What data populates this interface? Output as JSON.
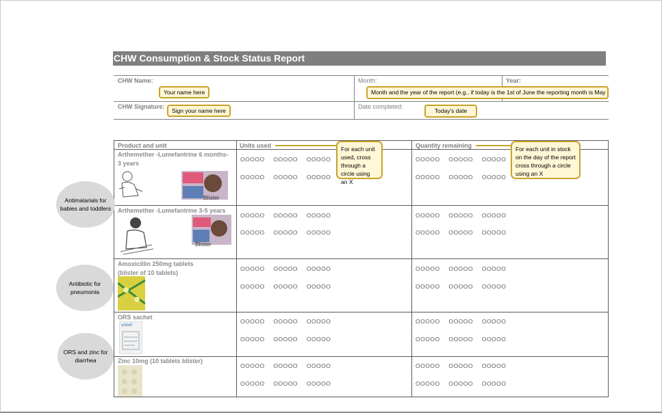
{
  "report": {
    "title": "CHW Consumption & Stock Status Report"
  },
  "header": {
    "chw_name_label": "CHW Name:",
    "chw_name_hint": "Your name here",
    "month_label": "Month:",
    "year_label": "Year:",
    "month_hint": "Month and the year of the report (e.g., if today is the 1st of June the reporting month is May",
    "signature_label": "CHW Signature:",
    "signature_hint": "Sign your name here",
    "date_label": "Date completed:",
    "date_hint": "Today's date"
  },
  "table": {
    "col_product": "Product and unit",
    "col_used": "Units used",
    "col_remaining": "Quantity remaining",
    "used_note": "For each unit used, cross through a circle using an X",
    "remaining_note": "For each unit in stock on the day of the report cross through a circle using an X",
    "circle_row": "OOOOO  OOOOO  OOOOO",
    "products": [
      {
        "line1": "Arthemether -Lumefantrine 6 months-",
        "line2": "3 years",
        "img_label": "Blister"
      },
      {
        "line1": "Arthemether -Lumefantrine 3-5 years",
        "line2": "",
        "img_label": "Blister"
      },
      {
        "line1": "Amoxicillin 250mg tablets",
        "line2": "(blister of 10 tablets)",
        "img_label": ""
      },
      {
        "line1": "ORS sachet",
        "line2": "",
        "img_label": "unicef"
      },
      {
        "line1": "Zinc 10mg (10 tablets blister)",
        "line2": "",
        "img_label": ""
      }
    ]
  },
  "side_labels": {
    "antimalarials": "Antimalarials for babies and toddlers",
    "antibiotic": "Antibiotic for pneumonia",
    "ors": "ORS and zinc for diarrhea"
  },
  "colors": {
    "title_bar": "#7f7f7f",
    "callout_fill": "#fff7d6",
    "callout_border": "#c9a227",
    "bubble": "#d9d9d9"
  }
}
